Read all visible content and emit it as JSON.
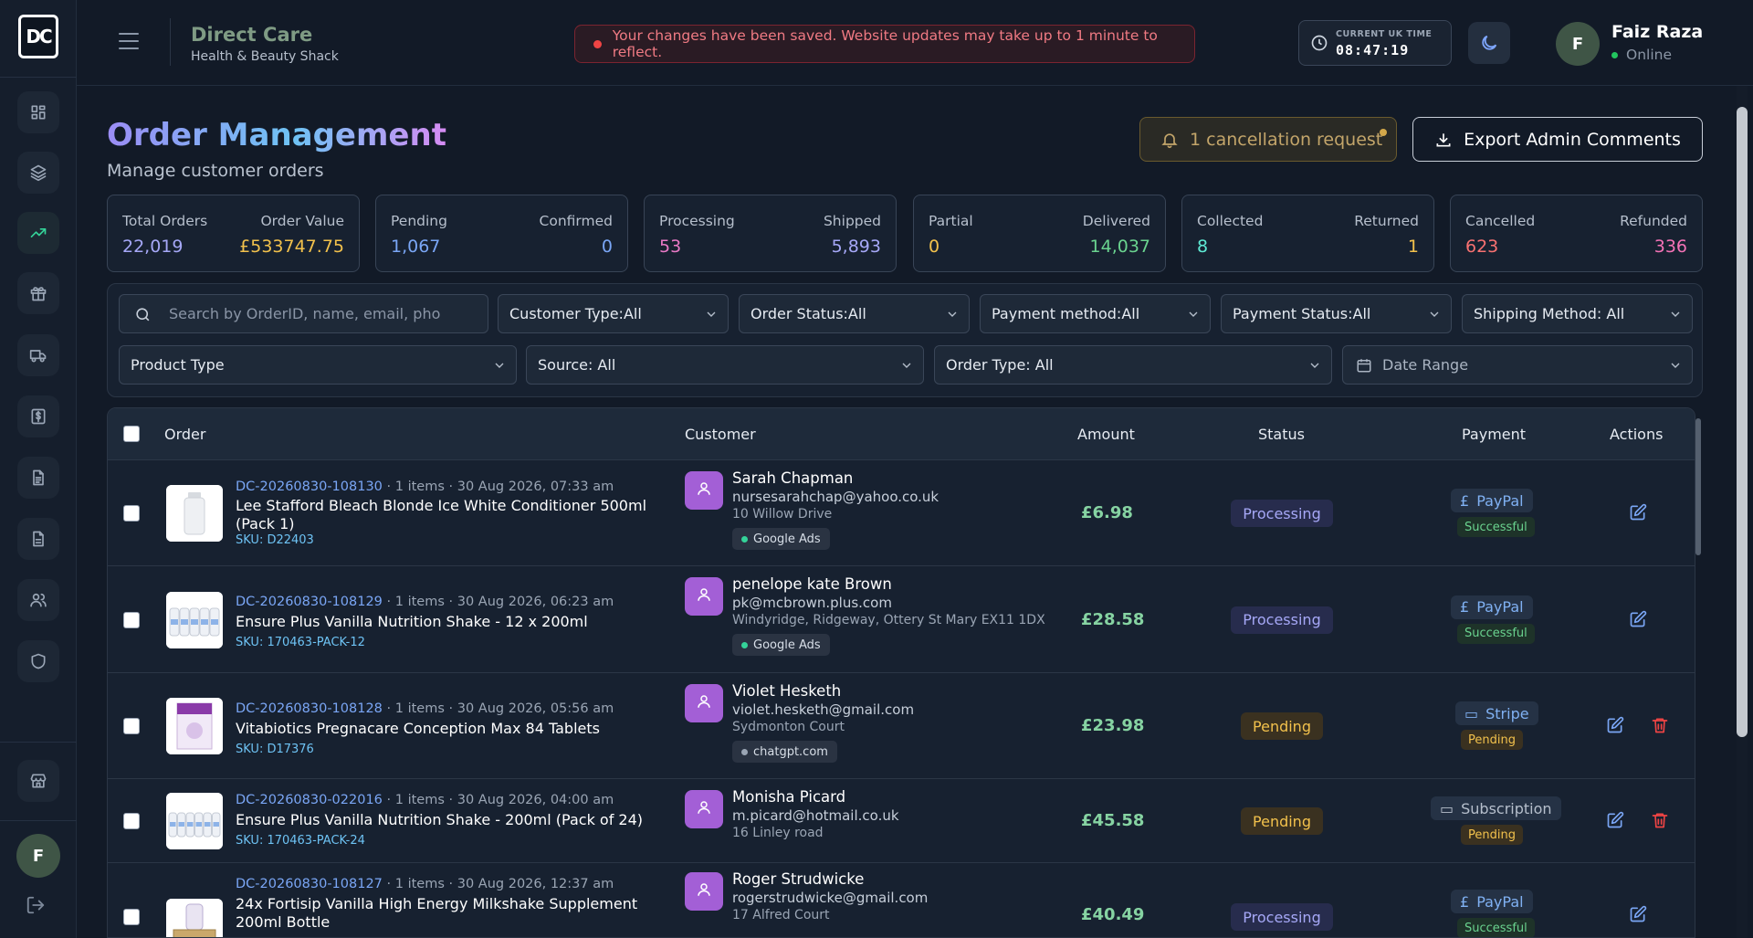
{
  "brand": {
    "logo_text": "DC",
    "title": "Direct Care",
    "subtitle": "Health & Beauty Shack"
  },
  "toast": {
    "message": "Your changes have been saved. Website updates may take up to 1 minute to reflect."
  },
  "clock": {
    "label": "CURRENT UK TIME",
    "time": "08:47:19"
  },
  "user": {
    "initial": "F",
    "name": "Faiz Raza",
    "status": "Online"
  },
  "page": {
    "title": "Order Management",
    "subtitle": "Manage customer orders"
  },
  "actions": {
    "cancellation": "1 cancellation request",
    "export": "Export Admin Comments"
  },
  "stats": [
    {
      "l_label": "Total Orders",
      "l_value": "22,019",
      "r_label": "Order Value",
      "r_value": "£533747.75",
      "l_color": "#a6a8f7",
      "r_color": "#f2c14c"
    },
    {
      "l_label": "Pending",
      "l_value": "1,067",
      "r_label": "Confirmed",
      "r_value": "0",
      "l_color": "#7aa6f5",
      "r_color": "#7aa6f5"
    },
    {
      "l_label": "Processing",
      "l_value": "53",
      "r_label": "Shipped",
      "r_value": "5,893",
      "l_color": "#e879c6",
      "r_color": "#a6a8f7"
    },
    {
      "l_label": "Partial",
      "l_value": "0",
      "r_label": "Delivered",
      "r_value": "14,037",
      "l_color": "#f2c14c",
      "r_color": "#6ad38f"
    },
    {
      "l_label": "Collected",
      "l_value": "8",
      "r_label": "Returned",
      "r_value": "1",
      "l_color": "#5eead4",
      "r_color": "#f2c14c"
    },
    {
      "l_label": "Cancelled",
      "l_value": "623",
      "r_label": "Refunded",
      "r_value": "336",
      "l_color": "#f87171",
      "r_color": "#f472b6"
    }
  ],
  "filters": {
    "search_placeholder": "Search by OrderID, name, email, pho",
    "customer_type": "Customer Type:All",
    "order_status": "Order Status:All",
    "payment_method": "Payment method:All",
    "payment_status": "Payment Status:All",
    "shipping_method": "Shipping Method: All",
    "product_type": "Product Type",
    "source": "Source: All",
    "order_type": "Order Type: All",
    "date_range": "Date Range"
  },
  "table": {
    "headers": {
      "order": "Order",
      "customer": "Customer",
      "amount": "Amount",
      "status": "Status",
      "payment": "Payment",
      "actions": "Actions"
    },
    "rows": [
      {
        "id": "DC-20260830-108130",
        "items": "1 items",
        "date": "30 Aug 2026, 07:33 am",
        "product": "Lee Stafford Bleach Blonde Ice White Conditioner 500ml (Pack 1)",
        "sku": "SKU: D22403",
        "name": "Sarah Chapman",
        "email": "nursesarahchap@yahoo.co.uk",
        "address": "10 Willow Drive",
        "tag": "Google Ads",
        "amount": "£6.98",
        "status": "Processing",
        "pay_method": "PayPal",
        "pay_icon": "pound-icon",
        "pay_status": "Successful"
      },
      {
        "id": "DC-20260830-108129",
        "items": "1 items",
        "date": "30 Aug 2026, 06:23 am",
        "product": "Ensure Plus Vanilla Nutrition Shake - 12 x 200ml",
        "sku": "SKU: 170463-PACK-12",
        "name": "penelope kate Brown",
        "email": "pk@mcbrown.plus.com",
        "address": "Windyridge, Ridgeway, Ottery St Mary EX11 1DX",
        "tag": "Google Ads",
        "amount": "£28.58",
        "status": "Processing",
        "pay_method": "PayPal",
        "pay_icon": "pound-icon",
        "pay_status": "Successful"
      },
      {
        "id": "DC-20260830-108128",
        "items": "1 items",
        "date": "30 Aug 2026, 05:56 am",
        "product": "Vitabiotics Pregnacare Conception Max 84 Tablets",
        "sku": "SKU: D17376",
        "name": "Violet Hesketh",
        "email": "violet.hesketh@gmail.com",
        "address": "Sydmonton Court",
        "tag": "chatgpt.com",
        "amount": "£23.98",
        "status": "Pending",
        "pay_method": "Stripe",
        "pay_icon": "card-icon",
        "pay_status": "Pending"
      },
      {
        "id": "DC-20260830-022016",
        "items": "1 items",
        "date": "30 Aug 2026, 04:00 am",
        "product": "Ensure Plus Vanilla Nutrition Shake - 200ml (Pack of 24)",
        "sku": "SKU: 170463-PACK-24",
        "name": "Monisha Picard",
        "email": "m.picard@hotmail.co.uk",
        "address": "16 Linley road",
        "tag": "",
        "amount": "£45.58",
        "status": "Pending",
        "pay_method": "Subscription",
        "pay_icon": "card-icon",
        "pay_status": "Pending"
      },
      {
        "id": "DC-20260830-108127",
        "items": "1 items",
        "date": "30 Aug 2026, 12:37 am",
        "product": "24x Fortisip Vanilla High Energy Milkshake Supplement 200ml Bottle",
        "sku": "",
        "name": "Roger Strudwicke",
        "email": "rogerstrudwicke@gmail.com",
        "address": "17 Alfred Court",
        "tag": "",
        "amount": "£40.49",
        "status": "Processing",
        "pay_method": "PayPal",
        "pay_icon": "pound-icon",
        "pay_status": "Successful"
      }
    ]
  }
}
